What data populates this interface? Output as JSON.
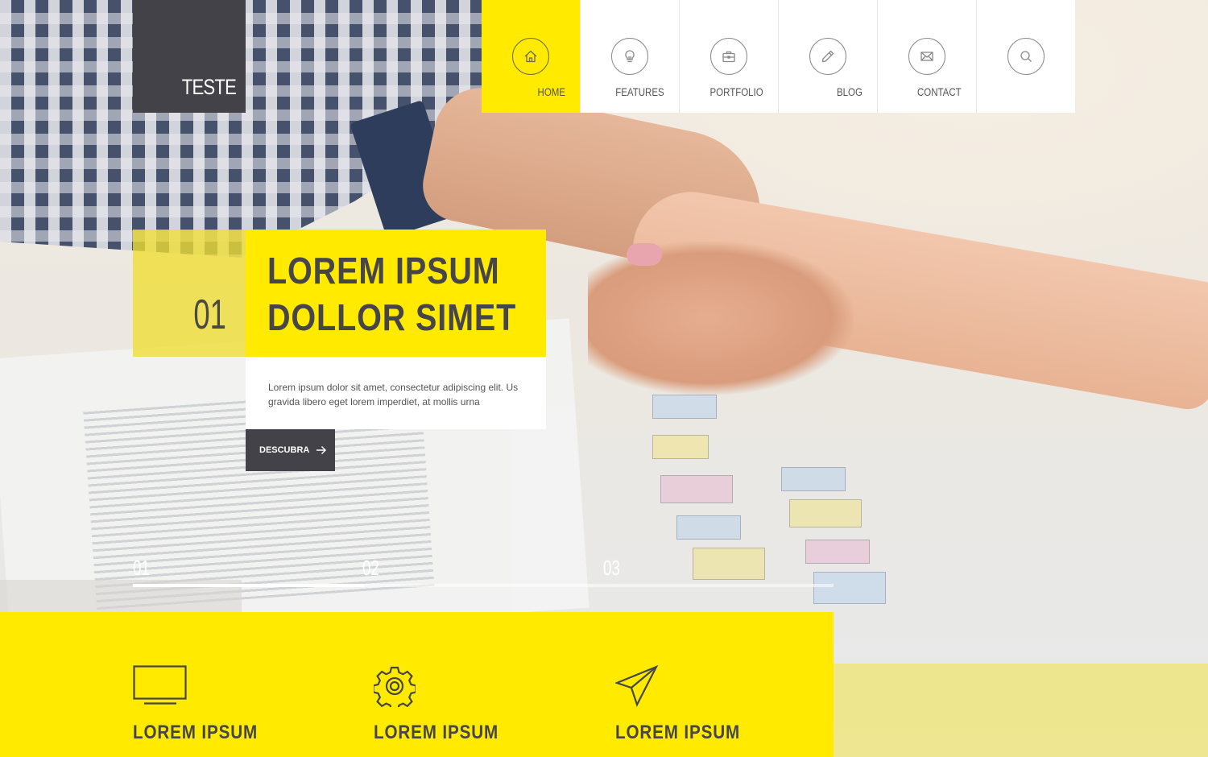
{
  "brand": {
    "name": "TESTE"
  },
  "colors": {
    "accent": "#ffea00",
    "dark": "#434248",
    "text": "#46464a"
  },
  "nav": {
    "items": [
      {
        "label": "HOME",
        "icon": "home-icon",
        "active": true
      },
      {
        "label": "FEATURES",
        "icon": "lightbulb-icon",
        "active": false
      },
      {
        "label": "PORTFOLIO",
        "icon": "briefcase-icon",
        "active": false
      },
      {
        "label": "BLOG",
        "icon": "pencil-icon",
        "active": false
      },
      {
        "label": "CONTACT",
        "icon": "envelope-icon",
        "active": false
      },
      {
        "label": "",
        "icon": "search-icon",
        "active": false
      }
    ]
  },
  "hero": {
    "number": "01",
    "title_line1": "LOREM IPSUM",
    "title_line2": "DOLLOR SIMET",
    "description": "Lorem ipsum dolor sit amet, consectetur adipiscing elit. Us gravida libero eget lorem imperdiet, at mollis urna",
    "cta_label": "DESCUBRA"
  },
  "slider": {
    "pages": [
      "01",
      "02",
      "03"
    ],
    "progress": 0.33
  },
  "features": [
    {
      "icon": "monitor-icon",
      "title": "LOREM IPSUM"
    },
    {
      "icon": "gear-icon",
      "title": "LOREM IPSUM"
    },
    {
      "icon": "paper-plane-icon",
      "title": "LOREM IPSUM"
    }
  ]
}
